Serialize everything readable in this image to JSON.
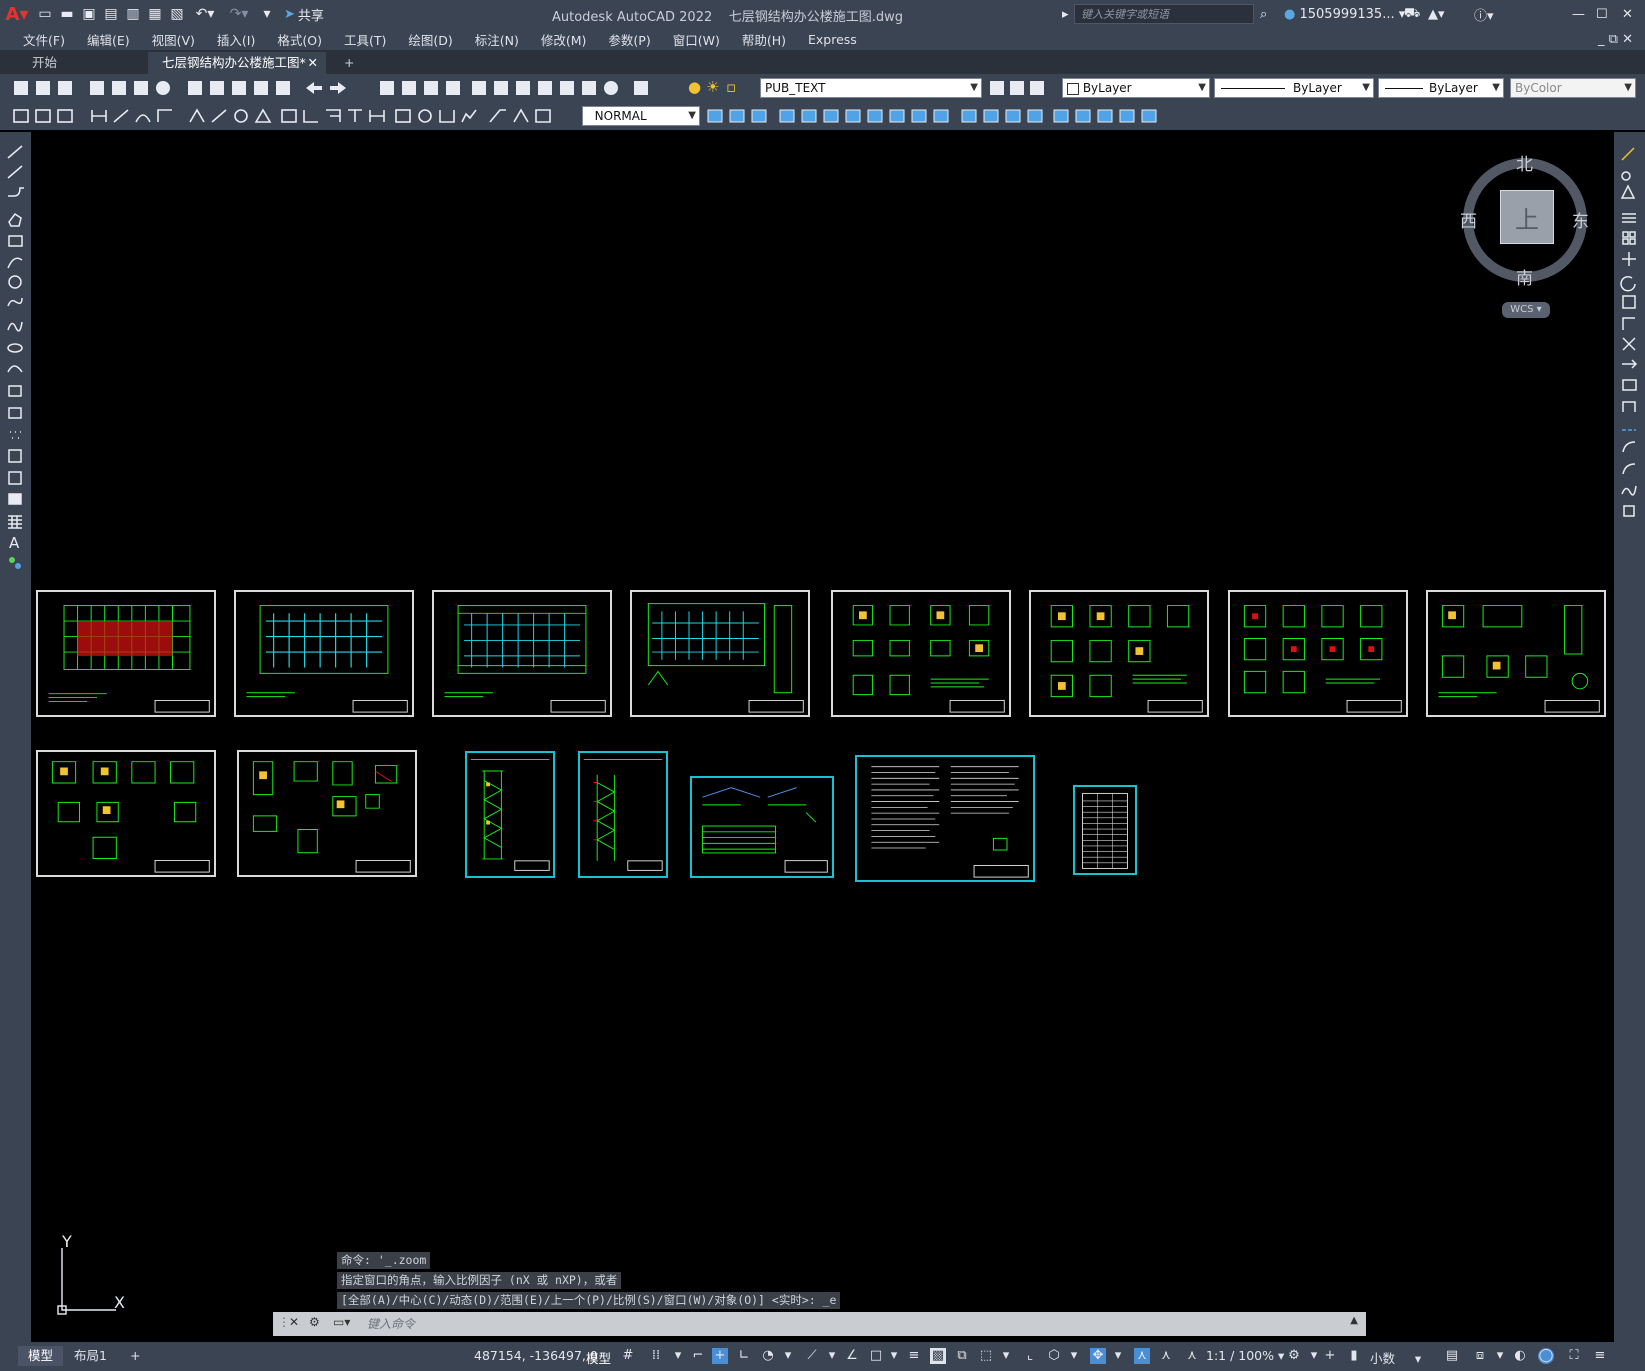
{
  "app": {
    "title": "Autodesk AutoCAD 2022    七层钢结构办公楼施工图.dwg",
    "search_placeholder": "键入关键字或短语",
    "user": "1505999135...",
    "share_label": "共享"
  },
  "menu": [
    "文件(F)",
    "编辑(E)",
    "视图(V)",
    "插入(I)",
    "格式(O)",
    "工具(T)",
    "绘图(D)",
    "标注(N)",
    "修改(M)",
    "参数(P)",
    "窗口(W)",
    "帮助(H)",
    "Express"
  ],
  "tabs": {
    "start": "开始",
    "active": "七层钢结构办公楼施工图*",
    "add": "+"
  },
  "toolbar": {
    "layer": "PUB_TEXT",
    "color": "ByLayer",
    "linetype": "ByLayer",
    "lineweight": "ByLayer",
    "plotstyle": "ByColor",
    "dimstyle": "NORMAL"
  },
  "viewcube": {
    "north": "北",
    "south": "南",
    "east": "东",
    "west": "西",
    "face": "上",
    "wcs": "WCS"
  },
  "command": {
    "history": [
      "命令: '_.zoom",
      "指定窗口的角点，输入比例因子 (nX 或 nXP)，或者",
      "[全部(A)/中心(C)/动态(D)/范围(E)/上一个(P)/比例(S)/窗口(W)/对象(O)] <实时>: _e"
    ],
    "placeholder": "键入命令"
  },
  "ucs": {
    "x": "X",
    "y": "Y"
  },
  "status": {
    "layout_tabs": [
      "模型",
      "布局1",
      "+"
    ],
    "coords": "487154, -136497, 0",
    "space": "模型",
    "scale": "1:1 / 100%",
    "units": "小数"
  },
  "colors": {
    "chrome": "#3b4453",
    "sheet_cyan": "#17c3d0",
    "line_green": "#19f019",
    "line_red": "#e01010"
  },
  "sheets": [
    {
      "kind": "plan-red"
    },
    {
      "kind": "plan"
    },
    {
      "kind": "plan"
    },
    {
      "kind": "plan"
    },
    {
      "kind": "detail"
    },
    {
      "kind": "detail"
    },
    {
      "kind": "detail"
    },
    {
      "kind": "detail"
    },
    {
      "kind": "detail"
    },
    {
      "kind": "detail"
    },
    {
      "kind": "stair"
    },
    {
      "kind": "stair"
    },
    {
      "kind": "section"
    },
    {
      "kind": "notes"
    },
    {
      "kind": "table"
    }
  ]
}
